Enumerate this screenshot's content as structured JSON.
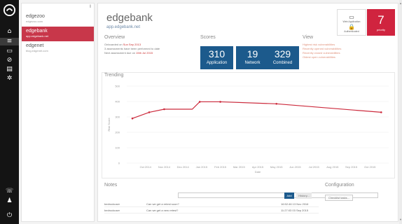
{
  "nav": {
    "items": [
      {
        "name": "home-icon",
        "glyph": "⌂"
      },
      {
        "name": "list-icon",
        "glyph": "≡"
      },
      {
        "name": "monitor-icon",
        "glyph": "▭"
      },
      {
        "name": "block-icon",
        "glyph": "⊘"
      },
      {
        "name": "document-icon",
        "glyph": "▤"
      },
      {
        "name": "settings-icon",
        "glyph": "✲"
      }
    ],
    "bottom": [
      {
        "name": "phone-icon",
        "glyph": "☏"
      },
      {
        "name": "user-icon",
        "glyph": "♟"
      },
      {
        "name": "power-icon",
        "glyph": "⏻"
      }
    ]
  },
  "sites": {
    "collapse_glyph": "‖",
    "items": [
      {
        "name": "edgezoo",
        "url": "edgezoo.com",
        "selected": false
      },
      {
        "name": "edgebank",
        "url": "app.edgebank.net",
        "selected": true
      },
      {
        "name": "edgenet",
        "url": "blog.edgenet.com",
        "selected": false
      }
    ]
  },
  "header": {
    "title": "edgebank",
    "subtitle": "app.edgebank.net",
    "tiles": [
      {
        "icon": "▭",
        "icon_name": "monitor-icon",
        "label": "Web Application"
      },
      {
        "icon": "🔒",
        "icon_name": "lock-icon",
        "label": "Authenticated"
      }
    ],
    "priority": {
      "value": "7",
      "label": "priority"
    }
  },
  "overview": {
    "heading": "Overview",
    "lines": [
      {
        "text": "Onboarded on ",
        "value": "Sun Sep 2013"
      },
      {
        "text": "3 assessments have been performed to date",
        "value": ""
      },
      {
        "text": "Next assessment due on ",
        "value": "15th Jul 2015"
      }
    ]
  },
  "scores": {
    "heading": "Scores",
    "items": [
      {
        "value": "310",
        "label": "Application"
      },
      {
        "value": "19",
        "label": "Network"
      },
      {
        "value": "329",
        "label": "Combined"
      }
    ]
  },
  "view": {
    "heading": "View",
    "links": [
      "Highest risk vulnerabilities",
      "Recently opened vulnerabilities",
      "Recently closed vulnerabilities",
      "Oldest open vulnerabilities"
    ]
  },
  "trending": {
    "heading": "Trending"
  },
  "chart_data": {
    "type": "line",
    "title": "",
    "xlabel": "Date",
    "ylabel": "Risk Score",
    "ylim": [
      0,
      500
    ],
    "yticks": [
      0,
      100,
      200,
      300,
      400,
      500
    ],
    "x_ticks": [
      "Oct 2014",
      "Nov 2014",
      "Dec 2014",
      "Jan 2015",
      "Feb 2015",
      "Mar 2015",
      "Apr 2015",
      "May 2015",
      "Jun 2015",
      "Jul 2015",
      "Aug 2015",
      "Sep 2015",
      "Oct 2015"
    ],
    "color": "#cc2a3c",
    "grid": true,
    "series": [
      {
        "x": [
          "Sep 2014",
          "Oct 2014",
          "Nov 2014",
          "Dec 2014",
          "Dec 2014",
          "Feb 2015",
          "May 2015",
          "Oct 2015"
        ],
        "values": [
          290,
          330,
          350,
          350,
          398,
          398,
          385,
          330
        ]
      }
    ]
  },
  "notes": {
    "heading": "Notes",
    "input_placeholder": "",
    "add_label": "Add",
    "more_label": "History...",
    "rows": [
      {
        "author": "bedrockuser",
        "text": "Can we get a retest soon?",
        "time": "16:52:46 13 Nov 2016"
      },
      {
        "author": "bedrockuser",
        "text": "Can we get a new retest?",
        "time": "11:27:03 03 Sep 2015"
      }
    ]
  },
  "configuration": {
    "heading": "Configuration",
    "button_label": "Checklist tasks..."
  },
  "colors": {
    "accent": "#c8374a",
    "score_blue": "#1c5a8c",
    "priority": "#d0243f"
  }
}
